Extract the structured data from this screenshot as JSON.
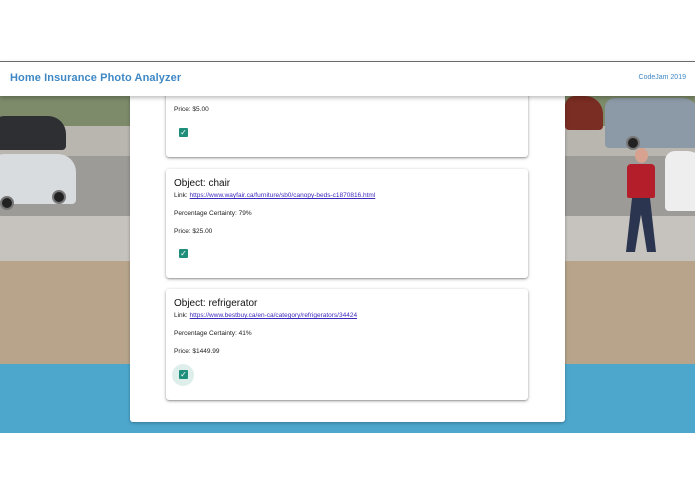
{
  "header": {
    "title": "Home Insurance Photo Analyzer",
    "right_text": "CodeJam 2019"
  },
  "cards": [
    {
      "price": "Price: $5.00",
      "checked": true
    },
    {
      "object": "Object: chair",
      "link_label": "Link:",
      "link_url": "https://www.wayfair.ca/furniture/sb0/canopy-beds-c1870816.html",
      "certainty": "Percentage Certainty: 79%",
      "price": "Price: $25.00",
      "checked": true
    },
    {
      "object": "Object: refrigerator",
      "link_label": "Link:",
      "link_url": "https://www.bestbuy.ca/en-ca/category/refrigerators/34424",
      "certainty": "Percentage Certainty: 41%",
      "price": "Price: $1449.99",
      "checked": true
    }
  ],
  "colors": {
    "accent": "#3f88c5",
    "checkbox": "#1f8e7a",
    "link": "#3a2bbf",
    "water": "#4da7cd"
  },
  "icons": {
    "checkbox": "check-icon"
  }
}
